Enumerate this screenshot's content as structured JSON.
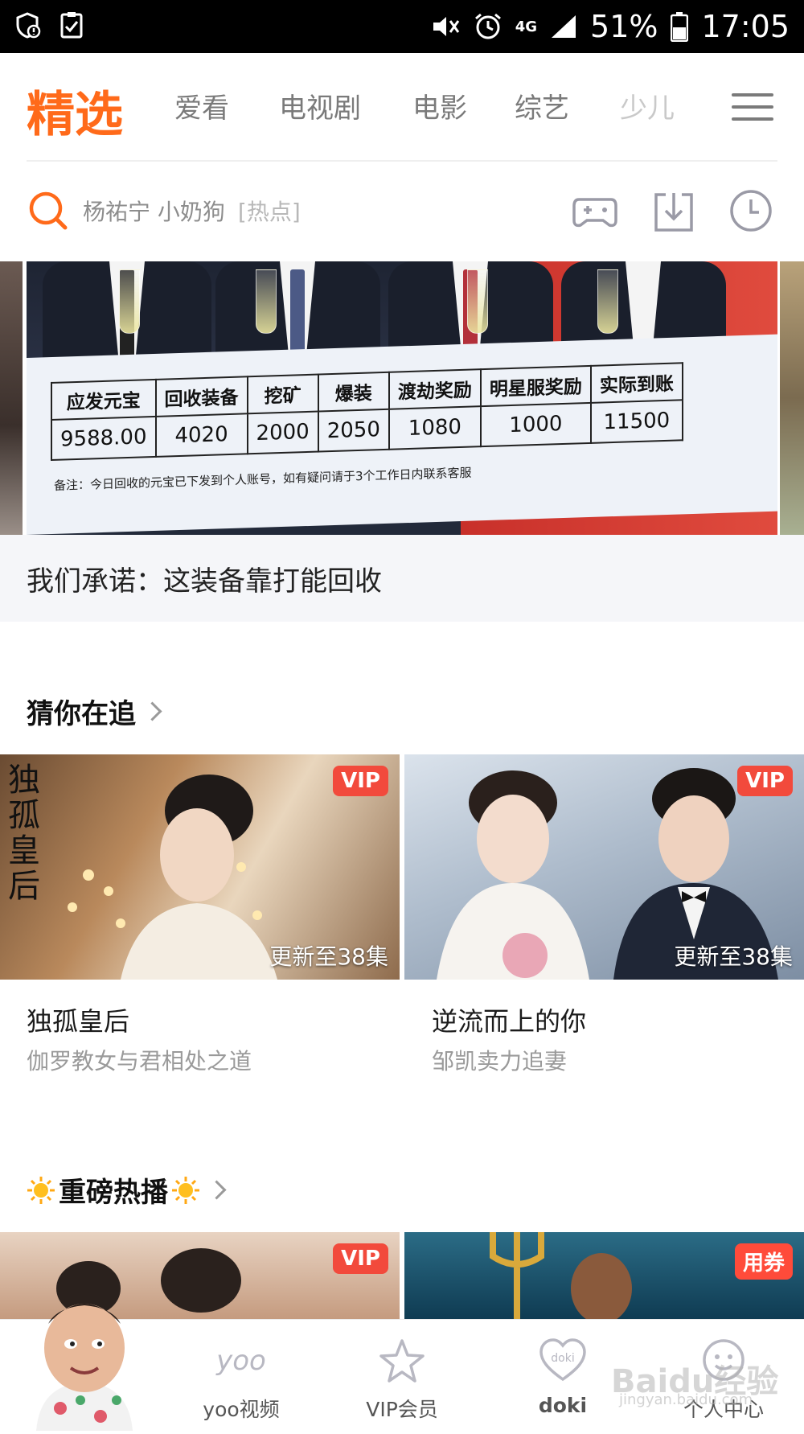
{
  "status_bar": {
    "battery": "51%",
    "time": "17:05",
    "network": "4G"
  },
  "nav": {
    "tabs": [
      "精选",
      "爱看",
      "电视剧",
      "电影",
      "综艺",
      "少儿"
    ],
    "active_index": 0,
    "accent_color": "#ff6a1a"
  },
  "search": {
    "query": "杨祐宁  小奶狗",
    "tag": "[热点]"
  },
  "banner": {
    "caption": "我们承诺：这装备靠打能回收",
    "check": {
      "headers": [
        "应发元宝",
        "回收装备",
        "挖矿",
        "爆装",
        "渡劫奖励",
        "明星服奖励",
        "实际到账"
      ],
      "values": [
        "9588.00",
        "4020",
        "2000",
        "2050",
        "1080",
        "1000",
        "11500"
      ],
      "note": "备注：今日回收的元宝已下发到个人账号，如有疑问请于3个工作日内联系客服"
    }
  },
  "section_guess": {
    "title": "猜你在追",
    "cards": [
      {
        "badge": "VIP",
        "update": "更新至38集",
        "title": "独孤皇后",
        "subtitle": "伽罗教女与君相处之道",
        "poster_text": "独孤皇后"
      },
      {
        "badge": "VIP",
        "update": "更新至38集",
        "title": "逆流而上的你",
        "subtitle": "邹凯卖力追妻"
      }
    ]
  },
  "section_hot": {
    "title": "重磅热播",
    "cards": [
      {
        "badge": "VIP"
      },
      {
        "badge": "用券"
      }
    ]
  },
  "bottom_nav": {
    "items": [
      "yoo视频",
      "VIP会员",
      "doki",
      "个人中心"
    ],
    "doki_icon_text": "doki",
    "yoo_icon_text": "yoo"
  },
  "watermark": {
    "text": "Baidu经验",
    "url": "jingyan.baidu.com"
  }
}
